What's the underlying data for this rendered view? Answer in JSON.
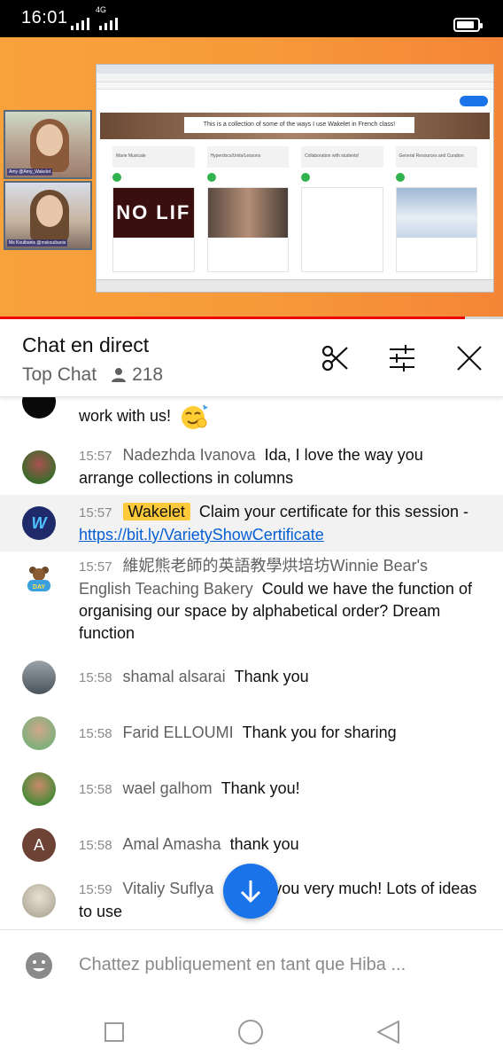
{
  "status_bar": {
    "time": "16:01",
    "network": "4G"
  },
  "video": {
    "screen_banner": "This is a collection of some of the ways I use Wakelet in French class!",
    "columns": [
      "Marie Musicale",
      "Hyperdocs/Units/Lessons",
      "Collaboration with students!",
      "General Resources and Curation"
    ],
    "card_text": "NO LIF",
    "webcam1_name": "Amy @Amy_Wakelet",
    "webcam2_name": "Ms Kouibanis @mskouibanis"
  },
  "chat_header": {
    "title": "Chat en direct",
    "mode": "Top Chat",
    "viewer_count": "218"
  },
  "messages": [
    {
      "time": "",
      "author": "",
      "text": "work with us!"
    },
    {
      "time": "15:57",
      "author": "Nadezhda Ivanova",
      "text": "Ida, I love the way you arrange collections in columns"
    },
    {
      "time": "15:57",
      "author": "Wakelet",
      "text": "Claim your certificate for this session - ",
      "link": "https://bit.ly/VarietyShowCertificate"
    },
    {
      "time": "15:57",
      "author": "維妮熊老師的英語教學烘培坊Winnie Bear's English Teaching Bakery",
      "text": "Could we have the function of organising our space by alphabetical order? Dream function"
    },
    {
      "time": "15:58",
      "author": "shamal alsarai",
      "text": "Thank you"
    },
    {
      "time": "15:58",
      "author": "Farid ELLOUMI",
      "text": "Thank you for sharing"
    },
    {
      "time": "15:58",
      "author": "wael galhom",
      "text": "Thank you!"
    },
    {
      "time": "15:58",
      "author": "Amal Amasha",
      "avatar_letter": "A",
      "text": "thank you"
    },
    {
      "time": "15:59",
      "author": "Vitaliy Suflya",
      "text": "you very much! Lots of ideas to use"
    }
  ],
  "input": {
    "placeholder": "Chattez publiquement en tant que Hiba ..."
  },
  "colors": {
    "accent": "#1a73e8",
    "badge": "#ffca3a",
    "link": "#065fd4",
    "progress": "#ff0000"
  }
}
